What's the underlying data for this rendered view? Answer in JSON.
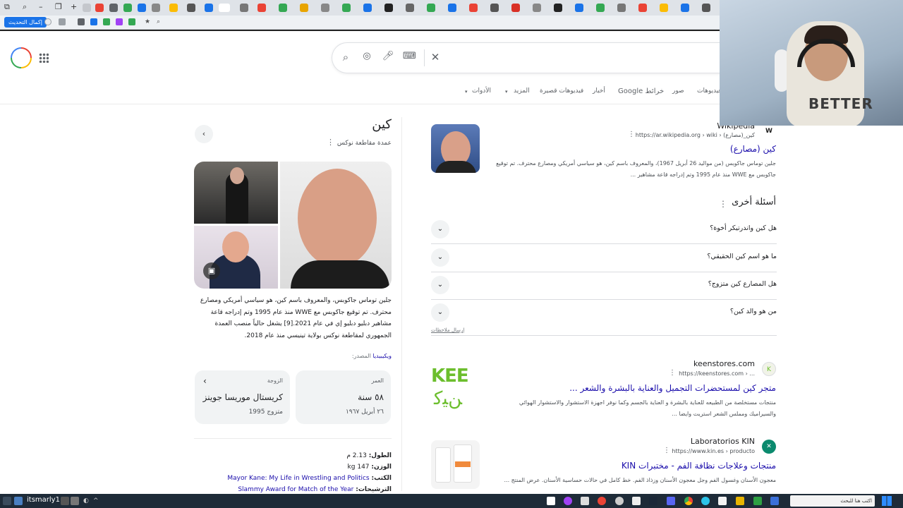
{
  "browser": {
    "update_button": "إكمال التحديث",
    "colors": {
      "tab_strip": "#dfe3e8",
      "accent": "#1a73e8"
    }
  },
  "search": {
    "icons": [
      "search-icon",
      "lens-icon",
      "mic-icon",
      "keyboard-icon",
      "clear-icon"
    ]
  },
  "nav_tabs": [
    "فيديوهات",
    "صور",
    "خرائط Google",
    "أخبار",
    "فيديوهات قصيرة",
    "المزيد",
    "الأدوات"
  ],
  "knowledge_panel": {
    "title": "كين",
    "subtitle": "عمدة مقاطعة نوكس",
    "description": "جلين توماس جاكوبس، والمعروف باسم كين، هو سياسي أمريكي ومصارع محترف. تم توقيع جاكوبس مع WWE منذ عام 1995 وتم إدراجه قاعة مشاهير دبليو دبليو إي في عام 2021.[9] يشغل حالياً منصب العمدة الجمهوري لمقاطعة نوكس بولاية تينيسي منذ عام 2018.",
    "source_label": "المصدر:",
    "source_link": "ويكيبيديا",
    "facts": [
      {
        "label": "العمر",
        "value": "٥٨ سنة",
        "sub": "٢٦ أبريل ١٩٦٧"
      },
      {
        "label": "الزوجة",
        "value": "كريستال موريسا جوينز",
        "sub": "متزوج 1995"
      }
    ],
    "rows": [
      {
        "label": "الطول:",
        "value": "2.13 م"
      },
      {
        "label": "الوزن:",
        "value": "147 kg"
      },
      {
        "label": "الكتب:",
        "value": "Mayor Kane: My Life in Wrestling and Politics"
      },
      {
        "label": "الترشيحات:",
        "value": "Slammy Award for Match of the Year"
      }
    ]
  },
  "results": {
    "wikipedia": {
      "site": "Wikipedia",
      "url": "https://ar.wikipedia.org › wiki › كين_(مصارع)",
      "title": "كين (مصارع)",
      "snippet": "جلين توماس جاكوبس (من مواليد 26 أبريل 1967)، والمعروف باسم كين، هو سياسي أمريكي ومصارع محترف. تم توقيع جاكوبس مع WWE منذ عام 1995 وتم إدراجه قاعة مشاهير ..."
    },
    "paa": {
      "title": "أسئلة أخرى",
      "questions": [
        "هل كين واندرتيكر أخوة؟",
        "ما هو اسم كين الحقيقي؟",
        "هل المصارع كين متزوج؟",
        "من هو والد كين؟"
      ],
      "feedback": "إرسال ملاحظات"
    },
    "keenstores": {
      "site": "keenstores.com",
      "url": "https://keenstores.com › ...",
      "title": "متجر كين لمستحضرات التجميل والعناية بالبشرة والشعر ...",
      "snippet": "منتجات مستخلصة من الطبيعه للعناية بالبشرة و العناية بالجسم وكما نوفر اجهزة الاستشوار والاستشوار الهوائي والسيراميك ومملس الشعر استريت وايضا ..."
    },
    "kin": {
      "site": "Laboratorios KIN",
      "url": "https://www.kin.es › producto",
      "title": "منتجات وعلاجات نظافة الفم - مختبرات KIN",
      "snippet": "معجون الأسنان وغسول الفم وجل معجون الأسنان وزذاذ الفم. خط كامل في حالات حساسية الأسنان. عرض المنتج ..."
    }
  },
  "webcam": {
    "shirt_text": "BETTER"
  },
  "taskbar": {
    "user": "itsmarly1",
    "search_placeholder": "اكتب هنا للبحث"
  }
}
